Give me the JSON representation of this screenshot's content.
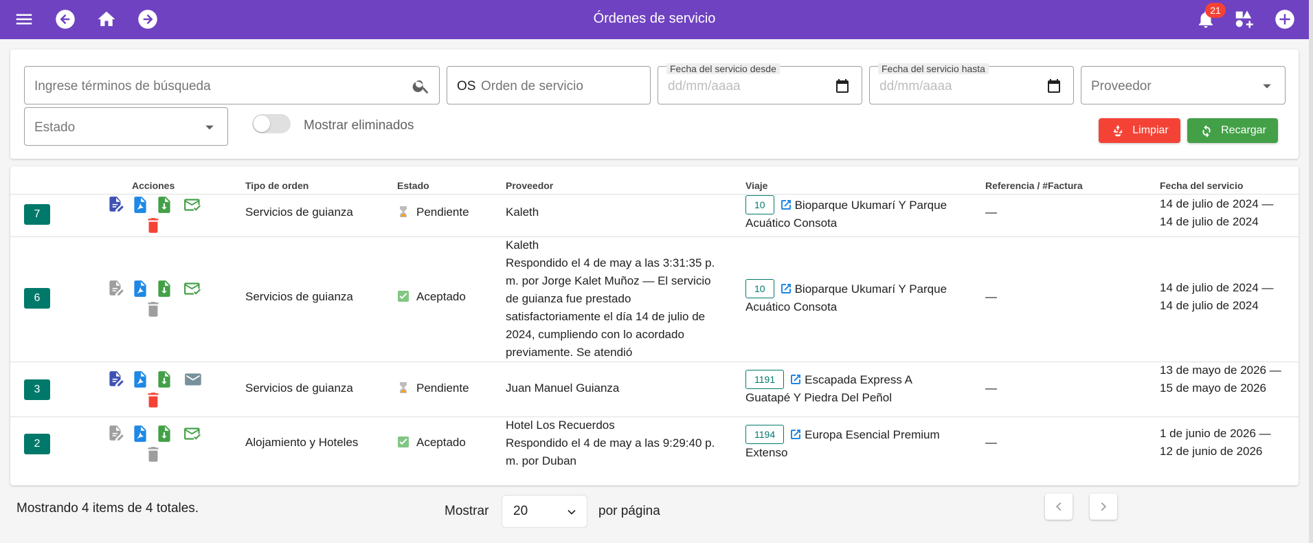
{
  "header": {
    "title": "Órdenes de servicio",
    "notification_count": "21",
    "bg_color": "#6f42c1"
  },
  "filters": {
    "search_placeholder": "Ingrese términos de búsqueda",
    "os_prefix": "OS",
    "os_placeholder": "Orden de servicio",
    "date_from_label": "Fecha del servicio desde",
    "date_from_placeholder": "dd/mm/aaaa",
    "date_to_label": "Fecha del servicio hasta",
    "date_to_placeholder": "dd/mm/aaaa",
    "provider_placeholder": "Proveedor",
    "status_placeholder": "Estado",
    "show_deleted_label": "Mostrar eliminados",
    "clear_label": "Limpiar",
    "reload_label": "Recargar"
  },
  "table": {
    "headers": {
      "actions": "Acciones",
      "order_type": "Tipo de orden",
      "status": "Estado",
      "provider": "Proveedor",
      "trip": "Viaje",
      "reference": "Referencia / #Factura",
      "service_date": "Fecha del servicio"
    },
    "rows": [
      {
        "number": "7",
        "order_type": "Servicios de guianza",
        "status": "Pendiente",
        "provider_name": "Kaleth",
        "provider_note": "",
        "trip_id": "10",
        "trip_name": "Bioparque Ukumarí Y Parque Acuático Consota",
        "reference": "—",
        "service_date": "14 de julio de 2024  —  14 de julio de 2024"
      },
      {
        "number": "6",
        "order_type": "Servicios de guianza",
        "status": "Aceptado",
        "provider_name": "Kaleth",
        "provider_note": "Respondido el 4 de may a las 3:31:35 p. m. por Jorge Kalet Muñoz  —  El servicio de guianza fue prestado satisfactoriamente el día 14 de julio de 2024, cumpliendo con lo acordado previamente. Se atendió",
        "trip_id": "10",
        "trip_name": "Bioparque Ukumarí Y Parque Acuático Consota",
        "reference": "—",
        "service_date": "14 de julio de 2024  —  14 de julio de 2024"
      },
      {
        "number": "3",
        "order_type": "Servicios de guianza",
        "status": "Pendiente",
        "provider_name": "Juan Manuel Guianza",
        "provider_note": "",
        "trip_id": "1191",
        "trip_name": "Escapada Express A Guatapé Y Piedra Del Peñol",
        "reference": "—",
        "service_date": "13 de mayo de 2026  —  15 de mayo de 2026"
      },
      {
        "number": "2",
        "order_type": "Alojamiento y Hoteles",
        "status": "Aceptado",
        "provider_name": "Hotel Los Recuerdos",
        "provider_note": "Respondido el 4 de may a las 9:29:40 p. m. por Duban",
        "trip_id": "1194",
        "trip_name": "Europa Esencial Premium Extenso",
        "reference": "—",
        "service_date": "1 de junio de 2026  —  12 de junio de 2026"
      }
    ]
  },
  "footer": {
    "summary": "Mostrando 4 items de 4 totales.",
    "show_label": "Mostrar",
    "page_size": "20",
    "per_page_label": "por página"
  }
}
